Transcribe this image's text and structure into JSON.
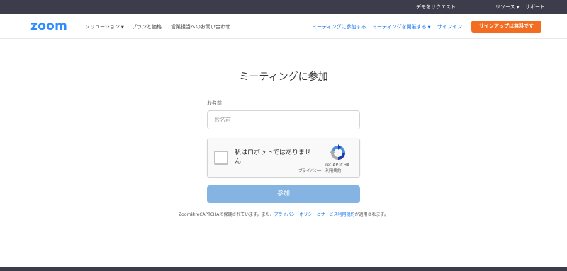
{
  "utility_bar": {
    "request_demo": "デモをリクエスト",
    "resources": "リソース",
    "support": "サポート"
  },
  "navbar": {
    "logo": "zoom",
    "solutions": "ソリューション",
    "pricing": "プランと価格",
    "contact_sales": "営業担当へのお問い合わせ",
    "join_meeting": "ミーティングに参加する",
    "host_meeting": "ミーティングを開催する",
    "sign_in": "サインイン",
    "sign_up": "サインアップは無料です"
  },
  "main": {
    "title": "ミーティングに参加",
    "name_label": "お名前",
    "name_placeholder": "お名前",
    "recaptcha": {
      "label": "私はロボットではありません",
      "brand": "reCAPTCHA",
      "privacy": "プライバシー",
      "separator": " - ",
      "terms": "利用規約"
    },
    "join_button": "参加",
    "legal": {
      "prefix": "ZoomはreCAPTCHAで保護されています。また、",
      "privacy_link": "プライバシーポリシー",
      "middle": "と",
      "terms_link": "サービス利用規約",
      "suffix": "が適用されます。"
    }
  },
  "colors": {
    "brand_blue": "#2d8cff",
    "link_blue": "#0e72ed",
    "signup_orange": "#f26d21",
    "join_button_disabled": "#86b4e2",
    "top_bar": "#3c3c4a"
  }
}
